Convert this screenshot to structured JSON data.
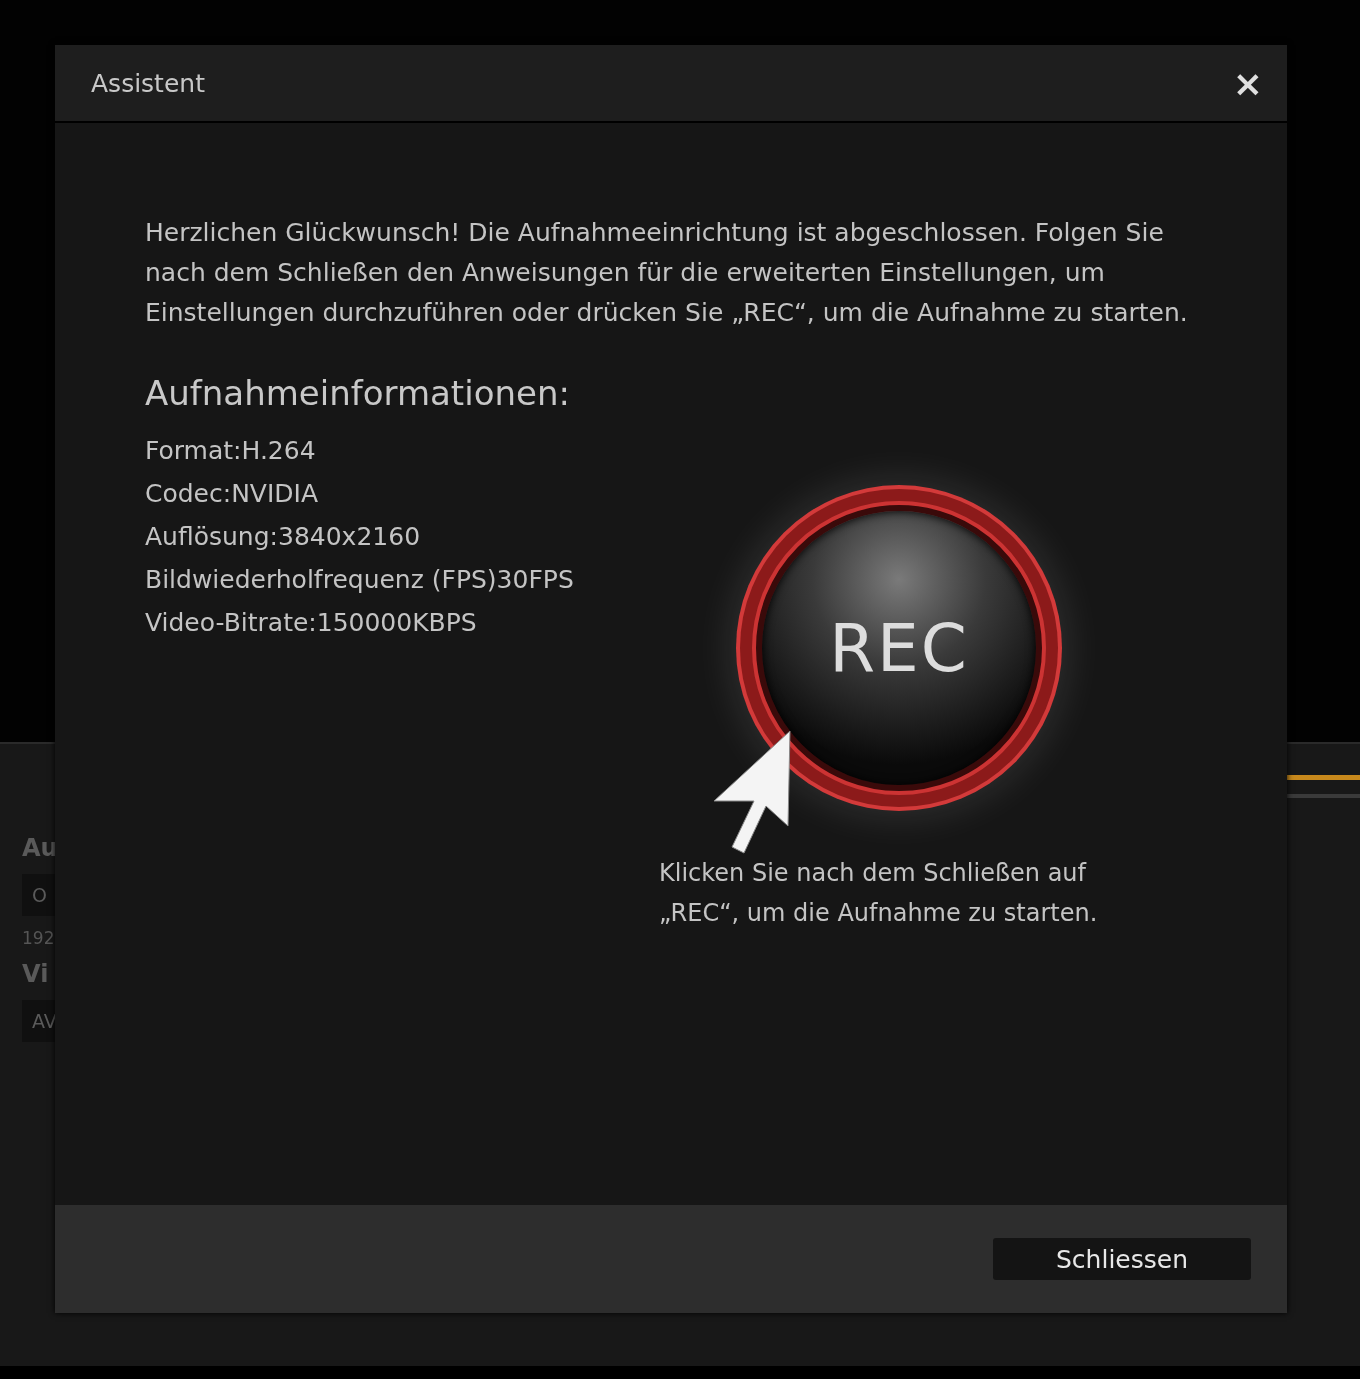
{
  "background_panel": {
    "texts": [
      {
        "kind": "heading",
        "text": "Au"
      },
      {
        "kind": "box",
        "text": "O"
      },
      {
        "kind": "small",
        "text": "192"
      },
      {
        "kind": "heading",
        "text": "Vi"
      },
      {
        "kind": "box",
        "text": "AV"
      }
    ]
  },
  "dialog": {
    "title": "Assistent",
    "close": "×",
    "intro": "Herzlichen Glückwunsch! Die Aufnahmeeinrichtung ist abgeschlossen. Folgen Sie nach dem Schließen den Anweisungen für die erweiterten Einstellungen, um Einstellungen durchzuführen oder drücken Sie „REC“, um die Aufnahme zu starten.",
    "info_heading": "Aufnahmeinformationen:",
    "info": [
      "Format:H.264",
      "Codec:NVIDIA",
      "Auflösung:3840x2160",
      "Bildwiederholfrequenz (FPS)30FPS",
      "Video-Bitrate:150000KBPS"
    ],
    "rec_label": "REC",
    "hint": "Klicken Sie nach dem Schließen auf „REC“, um die Aufnahme zu starten.",
    "buttons": [
      "Schliessen"
    ]
  }
}
